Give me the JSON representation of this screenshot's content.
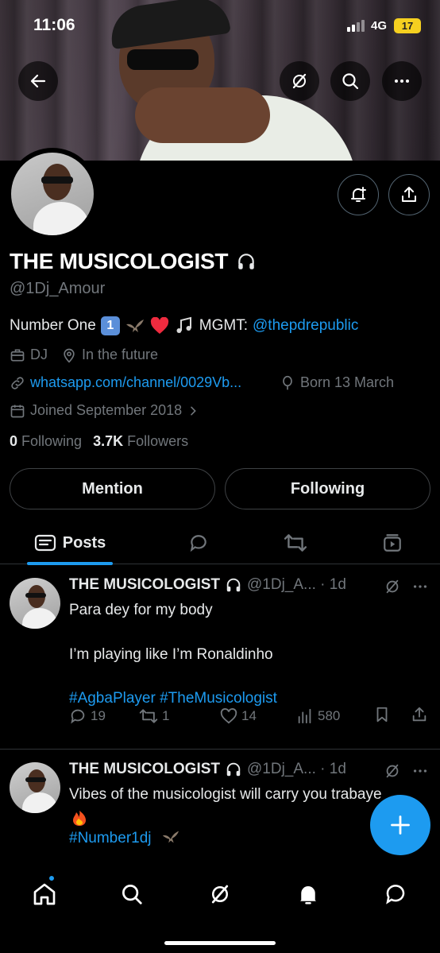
{
  "status_bar": {
    "time": "11:06",
    "network": "4G",
    "battery": "17"
  },
  "profile": {
    "name": "THE MUSICOLOGIST",
    "handle": "@1Dj_Amour",
    "bio_prefix": "Number One",
    "bio_key": "1",
    "bio_mgmt": "MGMT:",
    "bio_mgmt_link": "@thepdrepublic",
    "category": "DJ",
    "location": "In the future",
    "website": "whatsapp.com/channel/0029Vb...",
    "birthday": "Born 13 March",
    "joined": "Joined September 2018",
    "following_count": "0",
    "following_label": "Following",
    "followers_count": "3.7K",
    "followers_label": "Followers"
  },
  "buttons": {
    "mention": "Mention",
    "following": "Following"
  },
  "tabs": [
    {
      "label": "Posts"
    }
  ],
  "posts": [
    {
      "name": "THE MUSICOLOGIST",
      "handle_time": "@1Dj_A... · 1d",
      "lines": [
        "Para dey for my body",
        "I’m playing like I’m Ronaldinho"
      ],
      "hashtags": "#AgbaPlayer #TheMusicologist",
      "replies": "19",
      "reposts": "1",
      "likes": "14",
      "views": "580"
    },
    {
      "name": "THE MUSICOLOGIST",
      "handle_time": "@1Dj_A... · 1d",
      "lines": [
        "Vibes of the musicologist will carry you trabaye"
      ],
      "hashtags": "#Number1dj"
    }
  ],
  "colors": {
    "accent": "#1d9bf0",
    "muted": "#71767b",
    "text": "#e7e9ea",
    "background": "#000000"
  },
  "icons": [
    "back-arrow-icon",
    "grok-icon",
    "search-icon",
    "more-icon",
    "bell-plus-icon",
    "share-icon",
    "headphones-icon",
    "briefcase-icon",
    "location-icon",
    "link-icon",
    "balloon-icon",
    "calendar-icon",
    "posts-icon",
    "reply-icon",
    "repost-icon",
    "media-icon",
    "like-icon",
    "views-icon",
    "bookmark-icon",
    "compose-icon",
    "home-icon",
    "notifications-icon",
    "messages-icon"
  ]
}
